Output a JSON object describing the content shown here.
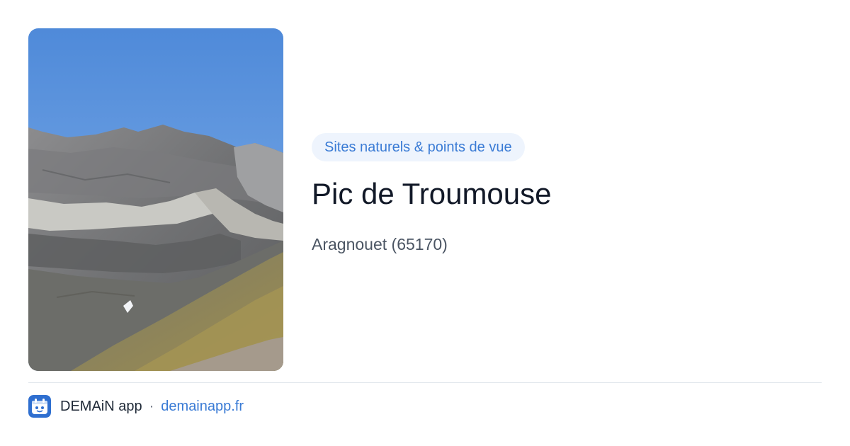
{
  "card": {
    "category": "Sites naturels & points de vue",
    "title": "Pic de Troumouse",
    "location": "Aragnouet (65170)",
    "image_subject": "mountain-landscape-photo"
  },
  "footer": {
    "app_name": "DEMAiN app",
    "separator": "·",
    "domain": "demainapp.fr",
    "logo_icon": "demain-app-logo-icon"
  },
  "colors": {
    "accent": "#3a7bd5",
    "chip_background": "#eef4fd",
    "title": "#111827",
    "subtitle": "#4b5563",
    "divider": "#e1e7ec",
    "sky": "#5a93dd"
  }
}
